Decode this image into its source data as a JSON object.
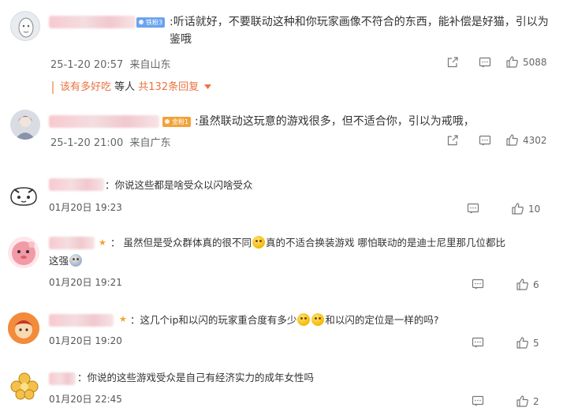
{
  "comments": [
    {
      "badge": "铁粉3",
      "text": ":听话就好，不要联动这种和你玩家画像不符合的东西，能补偿是好猫，引以为鉴哦",
      "time": "25-1-20 20:57",
      "location": "来自山东",
      "likes": "5088",
      "replies": {
        "nick": "该有多好吃",
        "mid": " 等人 ",
        "count": "共132条回复"
      }
    },
    {
      "badge": "金粉1",
      "text": ":虽然联动这玩意的游戏很多，但不适合你，引以为戒哦，",
      "time": "25-1-20 21:00",
      "location": "来自广东",
      "likes": "4302"
    },
    {
      "text": "：你说这些都是啥受众以闪啥受众",
      "time": "01月20日 19:23",
      "likes": "10"
    },
    {
      "text_a": "： 虽然但是受众群体真的很不同",
      "text_b": "真的不适合换装游戏 哪怕联动的是迪士尼里那几位都比",
      "text_c": "这强",
      "time": "01月20日 19:21",
      "likes": "6"
    },
    {
      "text_a": "：这几个ip和以闪的玩家重合度有多少",
      "text_b": "和以闪的定位是一样的吗?",
      "time": "01月20日 19:20",
      "likes": "5"
    },
    {
      "text": "：你说的这些游戏受众是自己有经济实力的成年女性吗",
      "time": "01月20日 22:45",
      "likes": "2"
    }
  ],
  "colors": {
    "accent": "#eb7340",
    "badge_blue": "#6aa3f0",
    "badge_gold": "#f2a23a"
  }
}
